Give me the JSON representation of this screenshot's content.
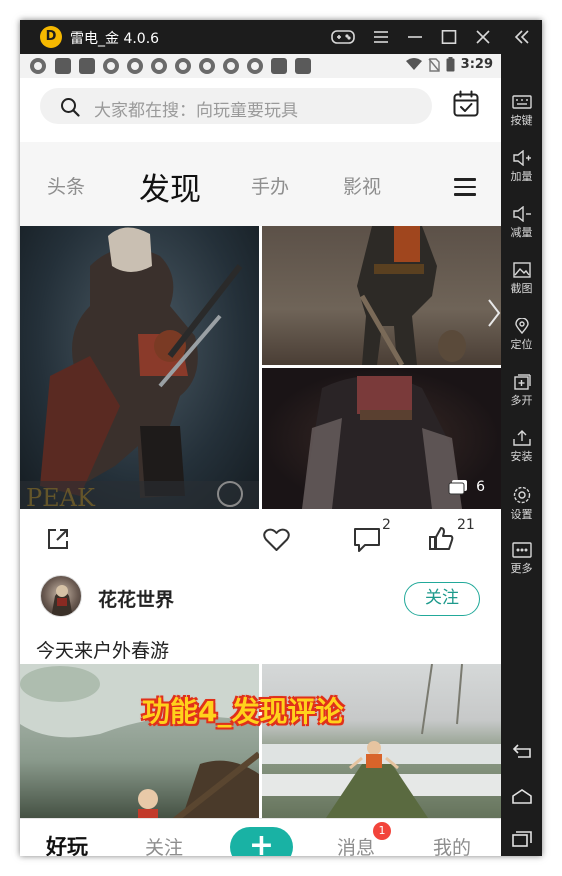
{
  "window": {
    "title": "雷电_金 4.0.6",
    "logo_text": "D"
  },
  "statusbar": {
    "time": "3:29"
  },
  "search": {
    "placeholder": "大家都在搜：向玩童要玩具"
  },
  "tabs": [
    {
      "label": "头条"
    },
    {
      "label": "发现"
    },
    {
      "label": "手办"
    },
    {
      "label": "影视"
    }
  ],
  "post1": {
    "photo_count": "6",
    "comment_count": "2",
    "like_count": "21",
    "author": "花花世界",
    "follow_label": "关注",
    "caption": "今天来户外春游"
  },
  "overlay": {
    "text": "功能4_发现评论"
  },
  "bottom_nav": {
    "items": [
      {
        "label": "好玩"
      },
      {
        "label": "关注"
      },
      {
        "label": "+"
      },
      {
        "label": "消息"
      },
      {
        "label": "我的"
      }
    ],
    "message_badge": "1"
  },
  "emulator_sidebar": {
    "items": [
      {
        "label": "按键",
        "icon": "keyboard-icon"
      },
      {
        "label": "加量",
        "icon": "volume-up-icon"
      },
      {
        "label": "减量",
        "icon": "volume-down-icon"
      },
      {
        "label": "截图",
        "icon": "screenshot-icon"
      },
      {
        "label": "定位",
        "icon": "location-icon"
      },
      {
        "label": "多开",
        "icon": "multi-instance-icon"
      },
      {
        "label": "安装",
        "icon": "install-icon"
      },
      {
        "label": "设置",
        "icon": "settings-icon"
      },
      {
        "label": "更多",
        "icon": "more-icon"
      }
    ]
  },
  "colors": {
    "accent": "#19b2a4",
    "badge": "#f2443b",
    "overlay_fill": "#ffd21c",
    "overlay_stroke": "#e0301a",
    "emulator_chrome": "#1c1c1c"
  }
}
